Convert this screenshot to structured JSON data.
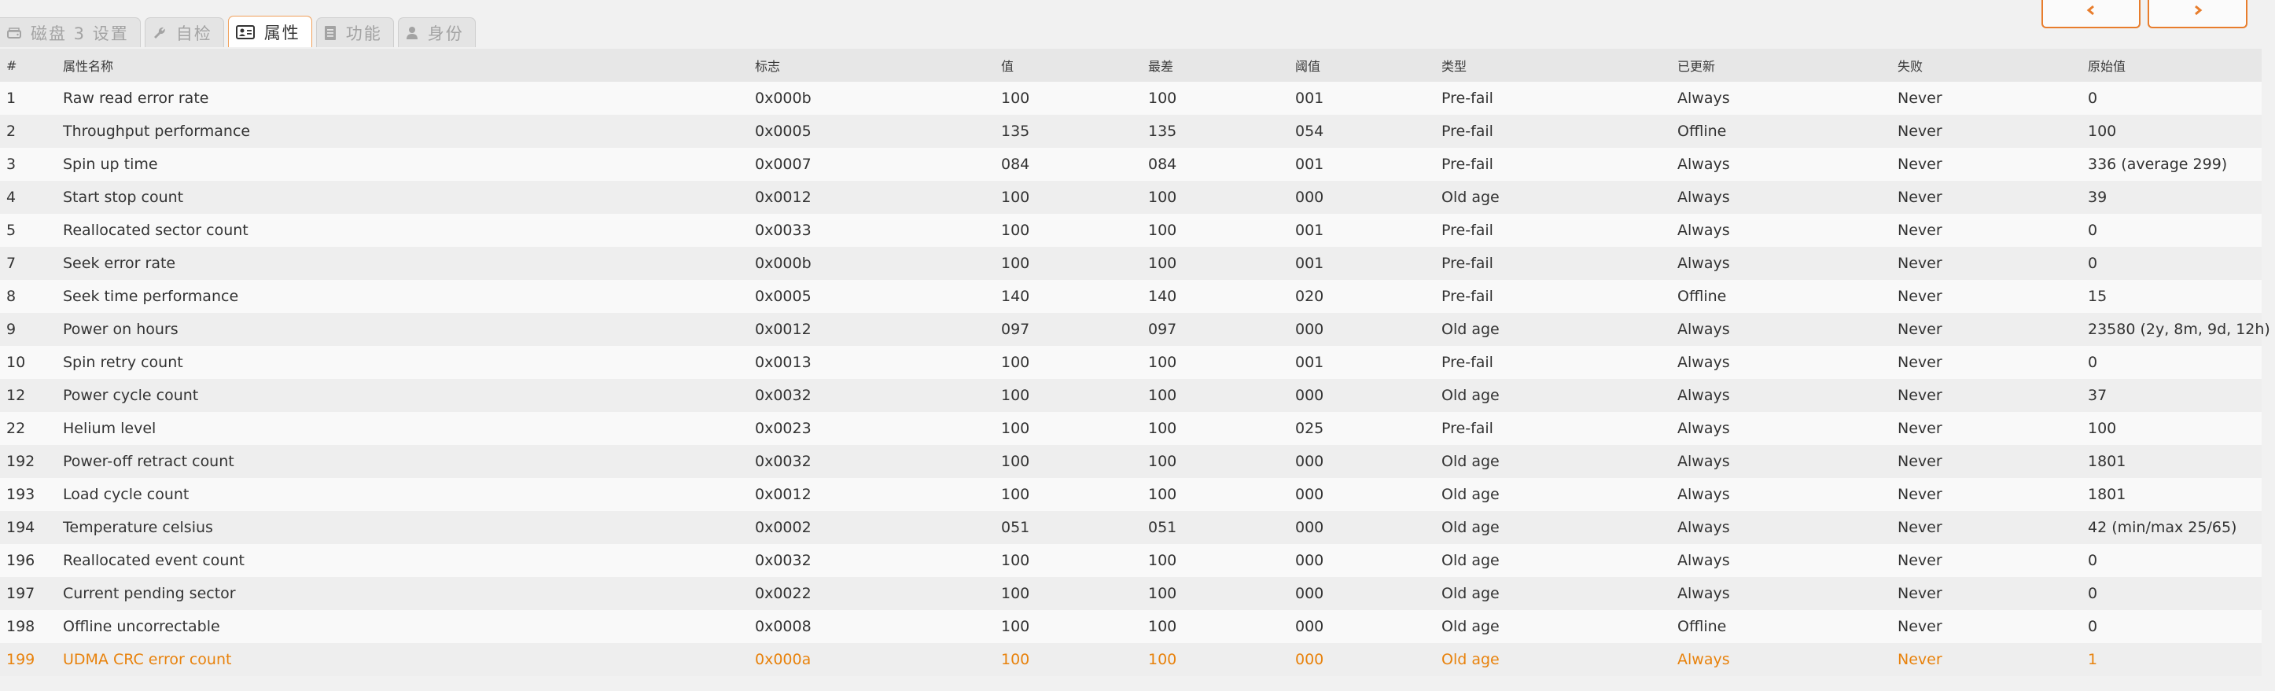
{
  "tabs": [
    {
      "label": "磁盘 3 设置",
      "icon": "hard-drive-icon",
      "active": false
    },
    {
      "label": "自检",
      "icon": "wrench-icon",
      "active": false
    },
    {
      "label": "属性",
      "icon": "id-card-icon",
      "active": true
    },
    {
      "label": "功能",
      "icon": "document-icon",
      "active": false
    },
    {
      "label": "身份",
      "icon": "user-icon",
      "active": false
    }
  ],
  "nav": {
    "prev_icon": "chevron-left-icon",
    "next_icon": "chevron-right-icon"
  },
  "colors": {
    "accent": "#e87d2c",
    "highlight_text": "#e8820c"
  },
  "table": {
    "headers": [
      "#",
      "属性名称",
      "标志",
      "值",
      "最差",
      "阈值",
      "类型",
      "已更新",
      "失败",
      "原始值"
    ],
    "rows": [
      [
        "1",
        "Raw read error rate",
        "0x000b",
        "100",
        "100",
        "001",
        "Pre-fail",
        "Always",
        "Never",
        "0"
      ],
      [
        "2",
        "Throughput performance",
        "0x0005",
        "135",
        "135",
        "054",
        "Pre-fail",
        "Offline",
        "Never",
        "100"
      ],
      [
        "3",
        "Spin up time",
        "0x0007",
        "084",
        "084",
        "001",
        "Pre-fail",
        "Always",
        "Never",
        "336 (average 299)"
      ],
      [
        "4",
        "Start stop count",
        "0x0012",
        "100",
        "100",
        "000",
        "Old age",
        "Always",
        "Never",
        "39"
      ],
      [
        "5",
        "Reallocated sector count",
        "0x0033",
        "100",
        "100",
        "001",
        "Pre-fail",
        "Always",
        "Never",
        "0"
      ],
      [
        "7",
        "Seek error rate",
        "0x000b",
        "100",
        "100",
        "001",
        "Pre-fail",
        "Always",
        "Never",
        "0"
      ],
      [
        "8",
        "Seek time performance",
        "0x0005",
        "140",
        "140",
        "020",
        "Pre-fail",
        "Offline",
        "Never",
        "15"
      ],
      [
        "9",
        "Power on hours",
        "0x0012",
        "097",
        "097",
        "000",
        "Old age",
        "Always",
        "Never",
        "23580 (2y, 8m, 9d, 12h)"
      ],
      [
        "10",
        "Spin retry count",
        "0x0013",
        "100",
        "100",
        "001",
        "Pre-fail",
        "Always",
        "Never",
        "0"
      ],
      [
        "12",
        "Power cycle count",
        "0x0032",
        "100",
        "100",
        "000",
        "Old age",
        "Always",
        "Never",
        "37"
      ],
      [
        "22",
        "Helium level",
        "0x0023",
        "100",
        "100",
        "025",
        "Pre-fail",
        "Always",
        "Never",
        "100"
      ],
      [
        "192",
        "Power-off retract count",
        "0x0032",
        "100",
        "100",
        "000",
        "Old age",
        "Always",
        "Never",
        "1801"
      ],
      [
        "193",
        "Load cycle count",
        "0x0012",
        "100",
        "100",
        "000",
        "Old age",
        "Always",
        "Never",
        "1801"
      ],
      [
        "194",
        "Temperature celsius",
        "0x0002",
        "051",
        "051",
        "000",
        "Old age",
        "Always",
        "Never",
        "42 (min/max 25/65)"
      ],
      [
        "196",
        "Reallocated event count",
        "0x0032",
        "100",
        "100",
        "000",
        "Old age",
        "Always",
        "Never",
        "0"
      ],
      [
        "197",
        "Current pending sector",
        "0x0022",
        "100",
        "100",
        "000",
        "Old age",
        "Always",
        "Never",
        "0"
      ],
      [
        "198",
        "Offline uncorrectable",
        "0x0008",
        "100",
        "100",
        "000",
        "Old age",
        "Offline",
        "Never",
        "0"
      ],
      [
        "199",
        "UDMA CRC error count",
        "0x000a",
        "100",
        "100",
        "000",
        "Old age",
        "Always",
        "Never",
        "1"
      ]
    ],
    "highlighted_rows": [
      17
    ]
  }
}
